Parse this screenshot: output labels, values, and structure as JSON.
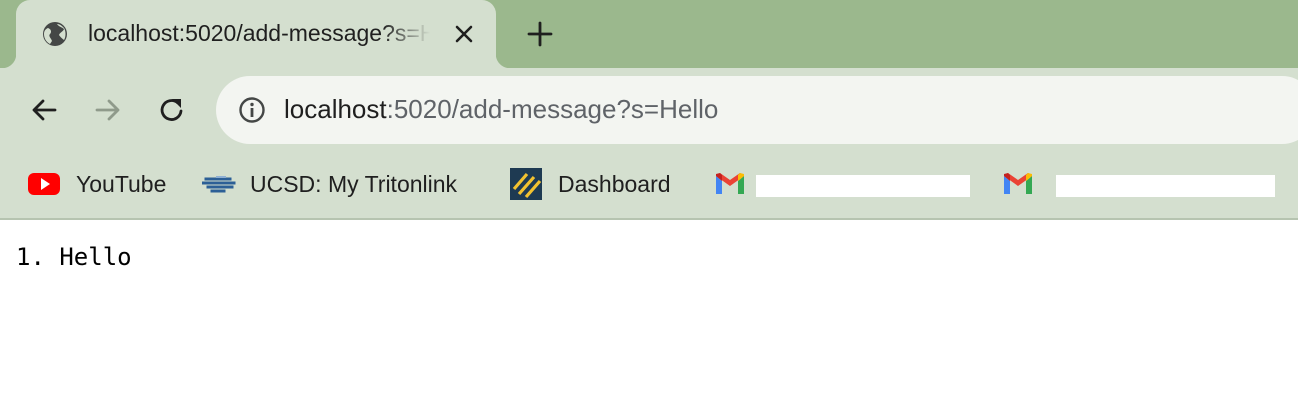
{
  "tab": {
    "title": "localhost:5020/add-message?s=Hello",
    "favicon": "globe-icon",
    "close_icon": "close-icon"
  },
  "new_tab_icon": "plus-icon",
  "nav": {
    "back_icon": "arrow-left-icon",
    "forward_icon": "arrow-right-icon",
    "reload_icon": "reload-icon"
  },
  "address_bar": {
    "host": "localhost",
    "rest": ":5020/add-message?s=Hello",
    "site_info_icon": "info-icon"
  },
  "bookmarks": [
    {
      "label": "YouTube",
      "icon": "youtube-icon"
    },
    {
      "label": "UCSD: My Tritonlink",
      "icon": "tritonlink-icon"
    },
    {
      "label": "Dashboard",
      "icon": "dashboard-icon"
    },
    {
      "label": "",
      "icon": "gmail-icon"
    },
    {
      "label": "",
      "icon": "gmail-icon"
    }
  ],
  "page": {
    "text": "1. Hello"
  },
  "colors": {
    "tab_strip": "#9bb88d",
    "toolbar": "#d4dfcf",
    "omnibox": "#f3f5f1"
  }
}
